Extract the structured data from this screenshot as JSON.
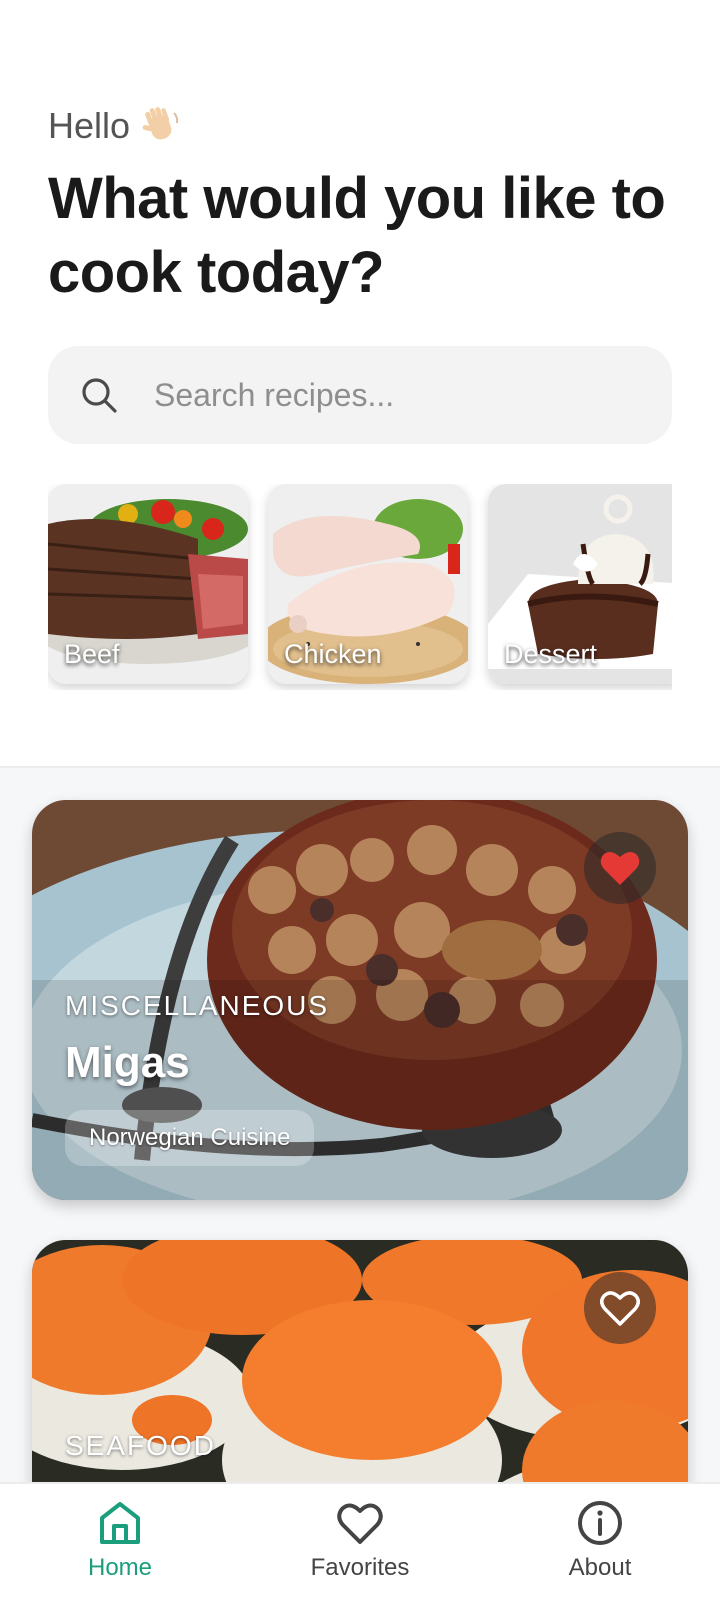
{
  "header": {
    "greeting": "Hello",
    "greeting_emoji": "waving-hand",
    "headline": "What would you like to cook today?"
  },
  "search": {
    "placeholder": "Search recipes...",
    "value": ""
  },
  "categories": [
    {
      "label": "Beef"
    },
    {
      "label": "Chicken"
    },
    {
      "label": "Dessert"
    }
  ],
  "recipes": [
    {
      "category": "MISCELLANEOUS",
      "name": "Migas",
      "cuisine": "Norwegian Cuisine",
      "favorited": true
    },
    {
      "category": "SEAFOOD",
      "name": "",
      "cuisine": "",
      "favorited": false
    }
  ],
  "nav": {
    "items": [
      {
        "label": "Home",
        "icon": "home-icon",
        "active": true
      },
      {
        "label": "Favorites",
        "icon": "heart-icon",
        "active": false
      },
      {
        "label": "About",
        "icon": "info-icon",
        "active": false
      }
    ]
  },
  "colors": {
    "accent": "#1b9e7c",
    "favorite": "#e53935",
    "search_bg": "#f3f3f3",
    "feed_bg": "#f6f7f9"
  }
}
